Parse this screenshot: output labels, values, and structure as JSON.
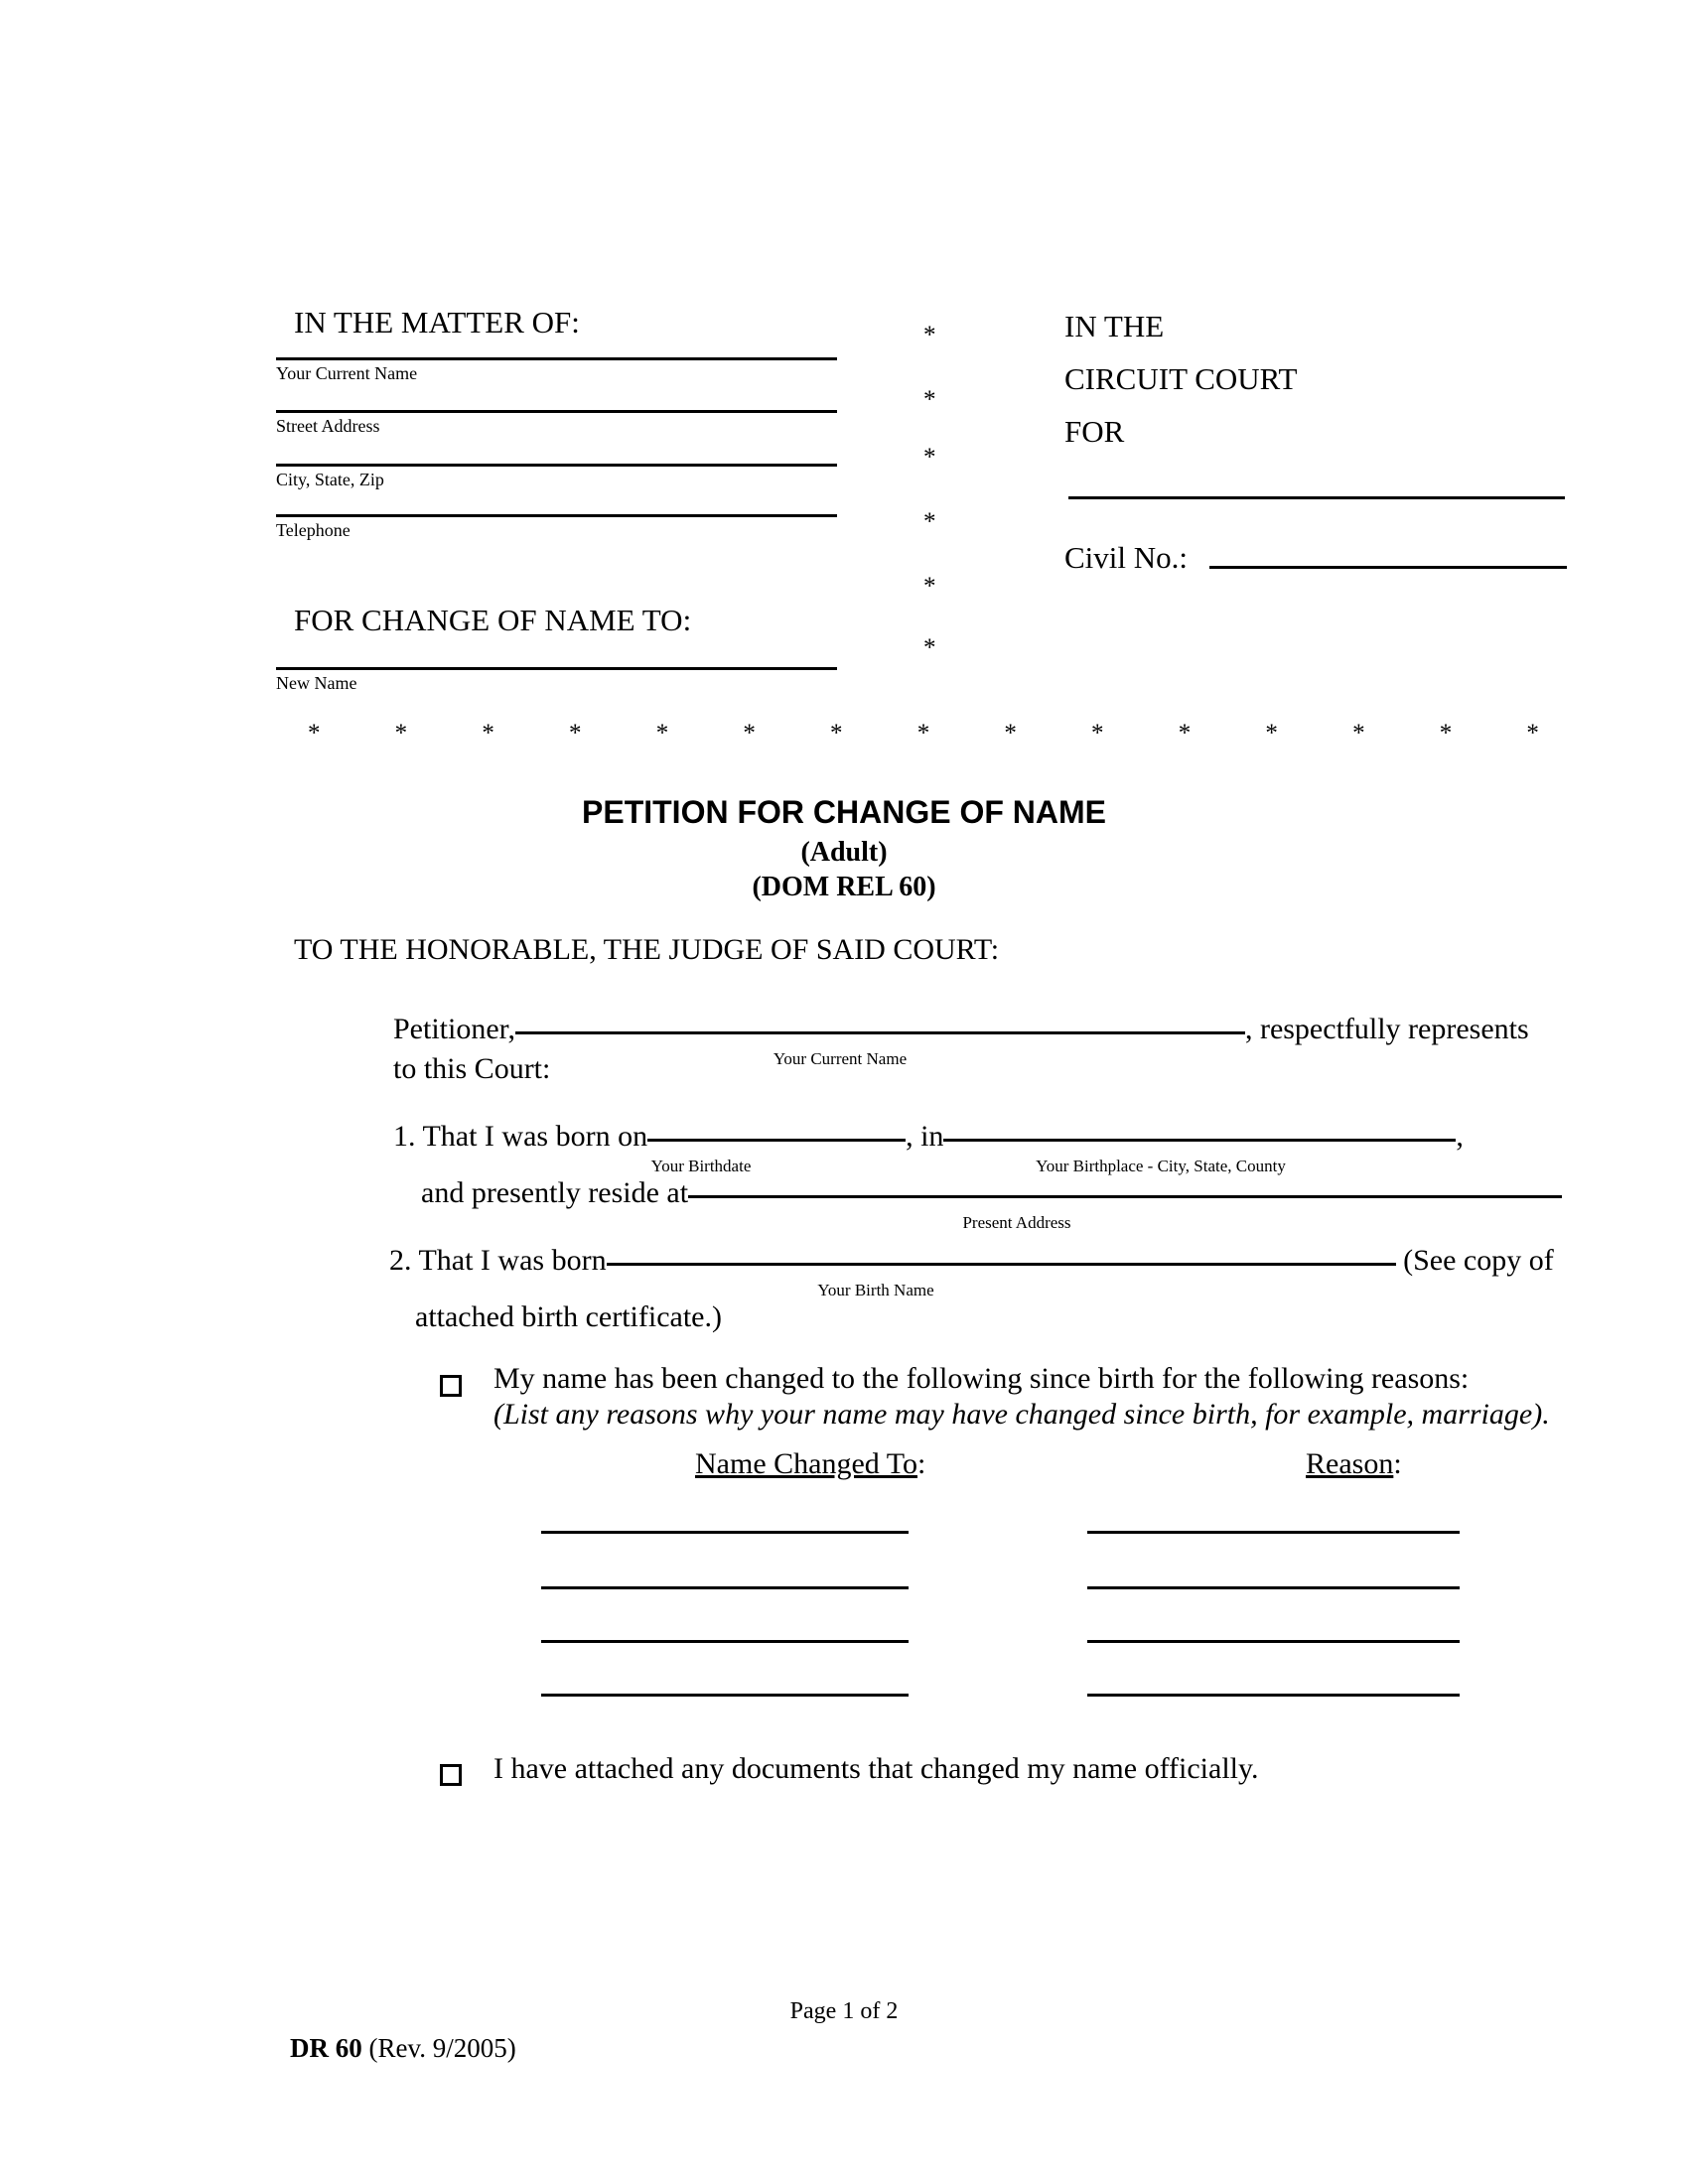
{
  "caption": {
    "matter_of": "IN THE MATTER OF:",
    "change_of_name_to": "FOR CHANGE OF NAME TO:",
    "fields": [
      {
        "label": "Your Current Name"
      },
      {
        "label": "Street Address"
      },
      {
        "label": "City, State, Zip"
      },
      {
        "label": "Telephone"
      }
    ],
    "new_name_label": "New Name",
    "star_glyph": "*",
    "star_column_count": 6,
    "star_row_count": 15
  },
  "court": {
    "in_the": "IN THE",
    "circuit_court": "CIRCUIT COURT",
    "for": "FOR",
    "civil_no_label": "Civil No.:"
  },
  "title": {
    "main": "PETITION FOR CHANGE OF NAME",
    "sub1": "(Adult)",
    "sub2": "(DOM REL 60)"
  },
  "body": {
    "honorable": "TO THE HONORABLE, THE JUDGE OF SAID COURT:",
    "petitioner_prefix": "Petitioner,",
    "petitioner_suffix": ", respectfully represents",
    "petitioner_caption": "Your Current Name",
    "to_this_court": "to this Court:",
    "item1_prefix": "1. That I was born on",
    "item1_mid": "in",
    "item1_suffix": ",",
    "item1_birthdate_caption": "Your Birthdate",
    "item1_birthplace_caption": "Your Birthplace - City, State, County",
    "item1b_prefix": "and presently reside at",
    "item1b_caption": "Present Address",
    "item2_prefix": "2. That I was born",
    "item2_suffix": "(See copy of",
    "item2_caption": "Your Birth Name",
    "item2b": "attached birth certificate.)"
  },
  "checkboxes": [
    {
      "text": "My name has been changed to the following since birth for the following reasons:",
      "italic_note": "(List any reasons why your name may have changed since birth, for example, marriage).",
      "checked": false
    },
    {
      "text": "I have attached any documents that changed my name officially.",
      "checked": false
    }
  ],
  "table": {
    "col1_header": "Name Changed To",
    "col1_colon": ":",
    "col2_header": "Reason",
    "col2_colon": ":",
    "row_count": 4
  },
  "footer": {
    "page": "Page 1 of 2",
    "form_id": "DR 60",
    "revision": "(Rev. 9/2005)"
  }
}
